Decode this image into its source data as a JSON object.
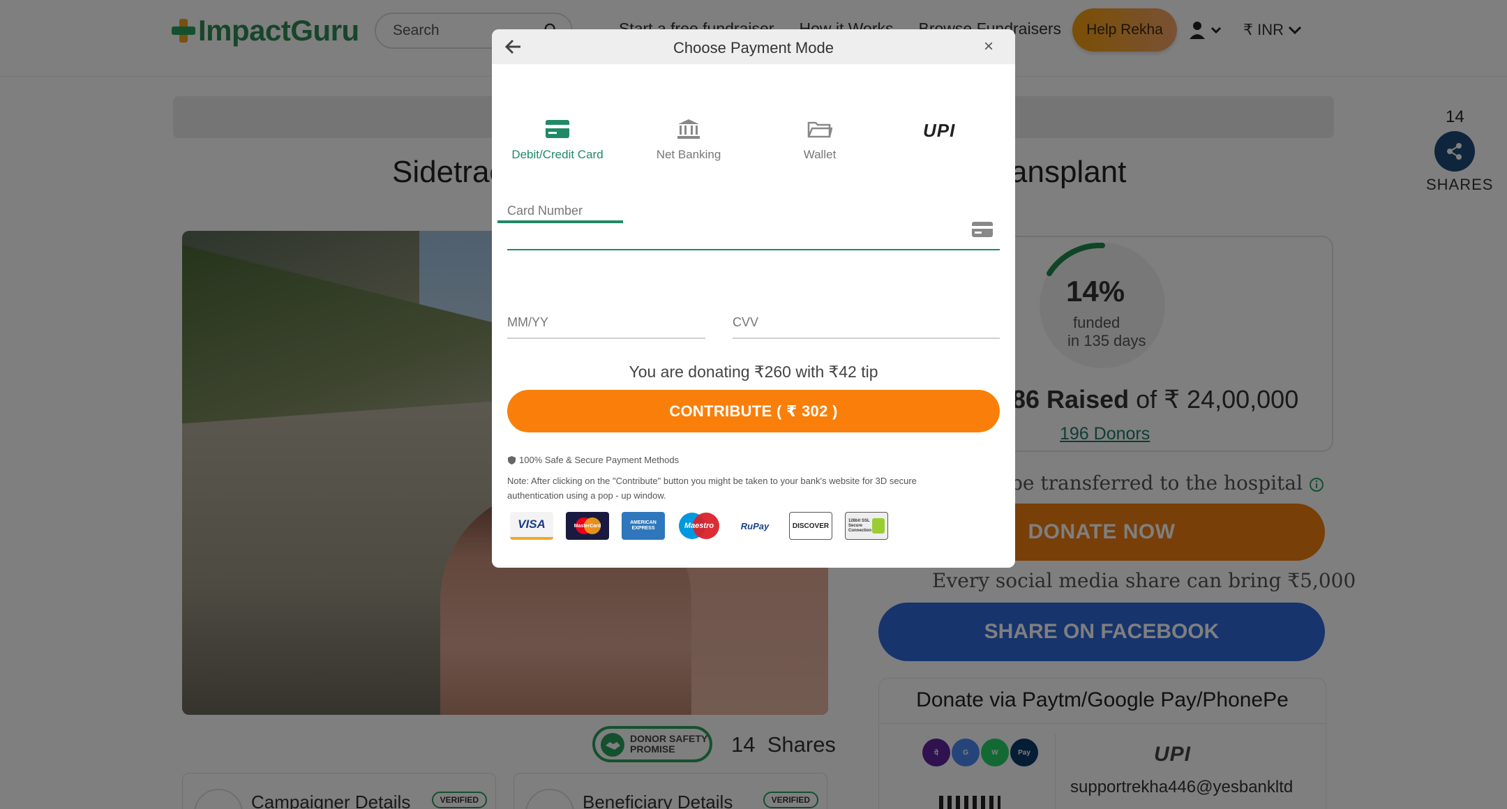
{
  "header": {
    "logo_text": "ImpactGuru",
    "search_placeholder": "Search",
    "nav": [
      "Start a free fundraiser",
      "How it Works",
      "Browse Fundraisers"
    ],
    "help_button": "Help Rekha",
    "currency": "₹ INR"
  },
  "campaign": {
    "title_start": "Sidetrac",
    "title_end": "ansplant",
    "share_count": "14",
    "shares_label": "SHARES",
    "promise_badge": "DONOR SAFETY PROMISE",
    "shares_text": "14  Shares",
    "campaigner_details": "Campaigner Details",
    "beneficiary_details": "Beneficiary Details",
    "verified": "VERIFIED"
  },
  "progress": {
    "percent": "14%",
    "funded": "funded",
    "days": "in 135 days",
    "percent_value": 14,
    "raised_amount": "86 Raised",
    "raised_of": "of ₹ 24,00,000",
    "donors": "196 Donors",
    "hospital_text": "be transferred to the hospital",
    "donate_now": "DONATE NOW",
    "social_text": "Every social media share can bring ₹5,000",
    "share_facebook": "SHARE ON FACEBOOK"
  },
  "upi_card": {
    "title": "Donate via Paytm/Google Pay/PhonePe",
    "upi_logo": "UPI",
    "upi_id": "supportrekha446@yesbankltd"
  },
  "modal": {
    "title": "Choose Payment Mode",
    "close": "×",
    "tabs": [
      {
        "label": "Debit/Credit Card"
      },
      {
        "label": "Net Banking"
      },
      {
        "label": "Wallet"
      },
      {
        "label": "UPI"
      }
    ],
    "card_number_label": "Card Number",
    "expiry_placeholder": "MM/YY",
    "cvv_placeholder": "CVV",
    "donating_text": "You are donating ₹260 with ₹42 tip",
    "contribute_button": "CONTRIBUTE ( ₹ 302 )",
    "safe_text": "100% Safe & Secure Payment Methods",
    "note_text": "Note: After clicking on the \"Contribute\" button you might be taken to your bank's website for 3D secure authentication using a pop - up window.",
    "card_brands": [
      "VISA",
      "MasterCard",
      "AMERICAN EXPRESS",
      "Maestro",
      "RuPay",
      "DISCOVER",
      "128bit SSL Secure Connection"
    ]
  },
  "colors": {
    "accent_green": "#1f8a66",
    "contribute_orange": "#f97f0a",
    "facebook_blue": "#2f68d8"
  }
}
